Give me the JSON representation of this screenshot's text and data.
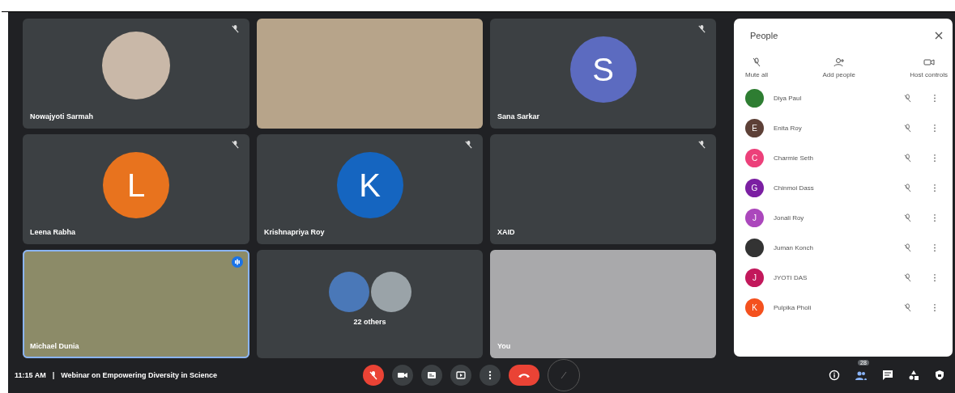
{
  "tiles": [
    {
      "kind": "photo-avatar",
      "name": "Nowajyoti Sarmah",
      "muted": true
    },
    {
      "kind": "video"
    },
    {
      "kind": "letter",
      "letter": "S",
      "color": "#5c6bc0",
      "name": "Sana Sarkar",
      "muted": true
    },
    {
      "kind": "letter",
      "letter": "L",
      "color": "#e8731e",
      "name": "Leena Rabha",
      "muted": true
    },
    {
      "kind": "letter",
      "letter": "K",
      "color": "#1565c0",
      "name": "Krishnapriya Roy",
      "muted": true
    },
    {
      "kind": "empty",
      "name": "XAID",
      "muted": true
    },
    {
      "kind": "video",
      "name": "Michael Dunia",
      "speaking": true
    },
    {
      "kind": "others",
      "name": "22 others"
    },
    {
      "kind": "video",
      "name": "You"
    }
  ],
  "people": {
    "title": "People",
    "actions": [
      {
        "kind": "mute",
        "label": "Mute all"
      },
      {
        "kind": "add",
        "label": "Add people"
      },
      {
        "kind": "host",
        "label": "Host controls"
      }
    ],
    "list": [
      {
        "kind": "photo",
        "name": "Diya Paul",
        "color": "#2e7d32"
      },
      {
        "kind": "letter",
        "letter": "E",
        "name": "Enita Roy",
        "color": "#5d4037"
      },
      {
        "kind": "letter",
        "letter": "C",
        "name": "Charmie Seth",
        "color": "#ec407a"
      },
      {
        "kind": "letter",
        "letter": "G",
        "name": "Chinmoi Dass",
        "color": "#7b1fa2"
      },
      {
        "kind": "letter",
        "letter": "J",
        "name": "Jonali Roy",
        "color": "#ab47bc"
      },
      {
        "kind": "photo",
        "name": "Juman Konch",
        "color": "#333333"
      },
      {
        "kind": "letter",
        "letter": "J",
        "name": "JYOTI DAS",
        "color": "#c2185b"
      },
      {
        "kind": "letter",
        "letter": "K",
        "name": "Pulpika Pholi",
        "color": "#f4511e"
      }
    ]
  },
  "bottom_bar": {
    "time": "11:15 AM",
    "separator": "|",
    "meeting_title": "Webinar on Empowering Diversity in Science",
    "mic_on": false,
    "people_count": "28"
  }
}
